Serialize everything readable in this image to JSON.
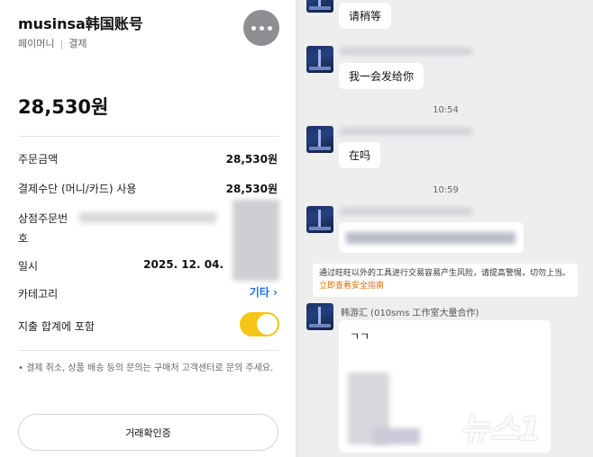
{
  "payment": {
    "title": "musinsa韩国账号",
    "sub_method": "페이머니",
    "sub_type": "결제",
    "amount": "28,530원",
    "rows": [
      {
        "label": "주문금액",
        "value": "28,530원"
      },
      {
        "label": "결제수단 (머니/카드) 사용",
        "value": "28,530원"
      },
      {
        "label_line1": "상점주문번",
        "label_line2": "호"
      },
      {
        "label": "일시",
        "value": "2025. 12. 04."
      },
      {
        "label": "카테고리",
        "value": "기타 ›"
      },
      {
        "label": "지출 합계에 포함"
      }
    ],
    "note": "• 결제 취소, 상품 배송 등의 문의는 구매처 고객센터로 문의 주세요.",
    "confirm_button": "거래확인증",
    "toggle_on": true,
    "colors": {
      "toggle": "#f5c518",
      "link": "#1f6fe0"
    }
  },
  "chat": {
    "messages": [
      {
        "text": "请稍等"
      },
      {
        "text": "我一会发给你"
      },
      {
        "time": "10:54"
      },
      {
        "text": "在吗"
      },
      {
        "time": "10:59"
      }
    ],
    "notice_text": "通过旺旺以外的工具进行交易容易产生风险，请提高警惕，切勿上当。",
    "notice_link": "立即查看安全指南",
    "sender_name": "韩游汇 (010sms 工作室大量合作)",
    "last_message": "ㄱㄱ",
    "colors": {
      "notice_link": "#e56b00"
    }
  },
  "watermark": "뉴스1"
}
